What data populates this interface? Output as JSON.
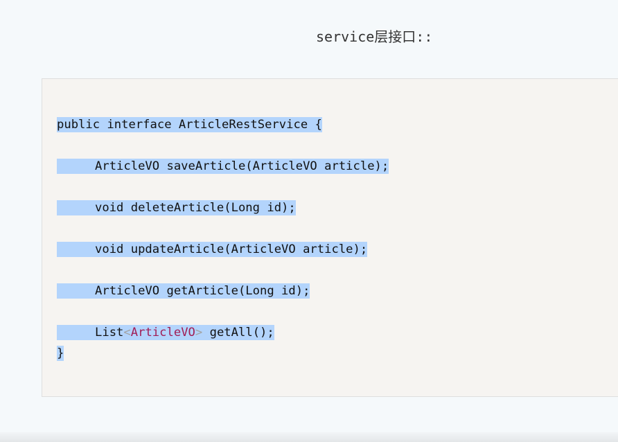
{
  "heading": {
    "text": "service层接口::"
  },
  "code": {
    "line1": "public interface ArticleRestService {",
    "line2": "ArticleVO saveArticle(ArticleVO article);",
    "line3": "void deleteArticle(Long id);",
    "line4": "void updateArticle(ArticleVO article);",
    "line5": "ArticleVO getArticle(Long id);",
    "line6": {
      "prefix": "List",
      "open_bracket": "<",
      "type": "ArticleVO",
      "close_bracket": ">",
      "suffix": " getAll();"
    },
    "line7": "}"
  },
  "colors": {
    "selection": "#b3d4fc",
    "code_background": "#f6f4f1",
    "generic_type": "#a11d55",
    "generic_bracket": "#a3a3a3"
  }
}
